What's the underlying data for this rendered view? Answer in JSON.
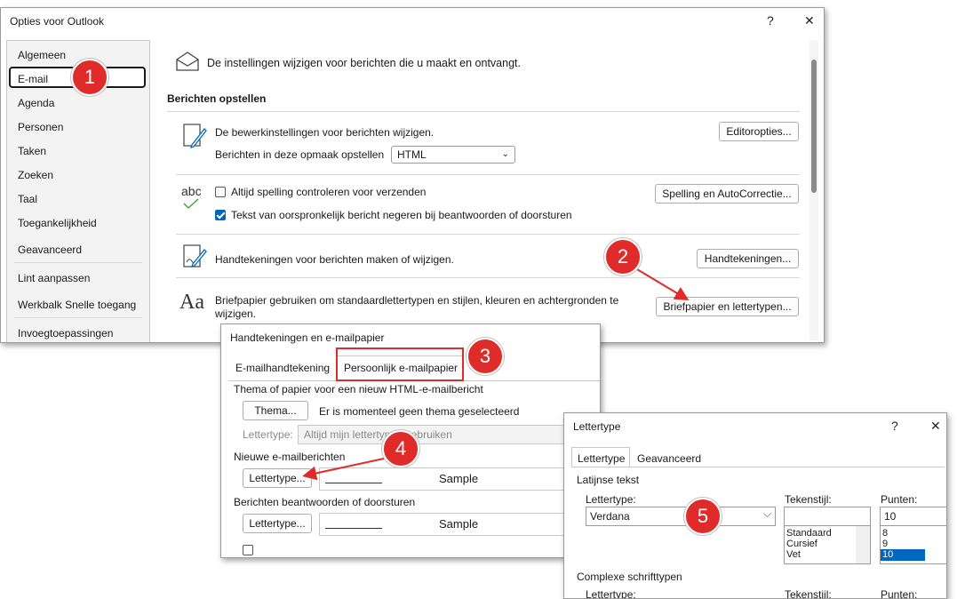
{
  "outlook_options": {
    "title": "Opties voor Outlook",
    "help": "?",
    "close": "✕",
    "nav": [
      "Algemeen",
      "E-mail",
      "Agenda",
      "Personen",
      "Taken",
      "Zoeken",
      "Taal",
      "Toegankelijkheid",
      "Geavanceerd",
      "Lint aanpassen",
      "Werkbalk Snelle toegang",
      "Invoegtoepassingen"
    ],
    "intro": "De instellingen wijzigen voor berichten die u maakt en ontvangt.",
    "section": "Berichten opstellen",
    "editor_text": "De bewerkinstellingen voor berichten wijzigen.",
    "editor_btn": "Editoropties...",
    "format_label": "Berichten in deze opmaak opstellen",
    "format_value": "HTML",
    "spell_check": "Altijd spelling controleren voor verzenden",
    "ignore_original": "Tekst van oorspronkelijk bericht negeren bij beantwoorden of doorsturen",
    "spell_btn": "Spelling en AutoCorrectie...",
    "abc": "abc",
    "sig_text": "Handtekeningen voor berichten maken of wijzigen.",
    "sig_btn": "Handtekeningen...",
    "stationery_text": "Briefpapier gebruiken om standaardlettertypen en stijlen, kleuren en achtergronden te wijzigen.",
    "stationery_btn": "Briefpapier en lettertypen...",
    "aa": "Aa"
  },
  "signatures": {
    "title": "Handtekeningen en e-mailpapier",
    "tab1": "E-mailhandtekening",
    "tab2": "Persoonlijk e-mailpapier",
    "theme_heading": "Thema of papier voor een nieuw HTML-e-mailbericht",
    "theme_btn": "Thema...",
    "theme_status": "Er is momenteel geen thema geselecteerd",
    "font_label": "Lettertype:",
    "font_value": "Altijd mijn lettertypen gebruiken",
    "new_heading": "Nieuwe e-mailberichten",
    "font_btn": "Lettertype...",
    "sample": "Sample",
    "reply_heading": "Berichten beantwoorden of doorsturen",
    "font_btn2": "Lettertype...",
    "sample2": "Sample"
  },
  "font_dialog": {
    "title": "Lettertype",
    "help": "?",
    "close": "✕",
    "tab1": "Lettertype",
    "tab2": "Geavanceerd",
    "latin": "Latijnse tekst",
    "font_label": "Lettertype:",
    "font_value": "Verdana",
    "style_label": "Tekenstijl:",
    "styles": [
      "Standaard",
      "Cursief",
      "Vet"
    ],
    "size_label": "Punten:",
    "size_value": "10",
    "sizes": [
      "8",
      "9",
      "10"
    ],
    "complex": "Complexe schrifttypen",
    "font_label2": "Lettertype:",
    "style_label2": "Tekenstijl:",
    "size_label2": "Punten:"
  },
  "badges": [
    "1",
    "2",
    "3",
    "4",
    "5"
  ],
  "colors": {
    "badge": "#e02b2b",
    "accent": "#0067c0",
    "selection": "#0067c0"
  }
}
